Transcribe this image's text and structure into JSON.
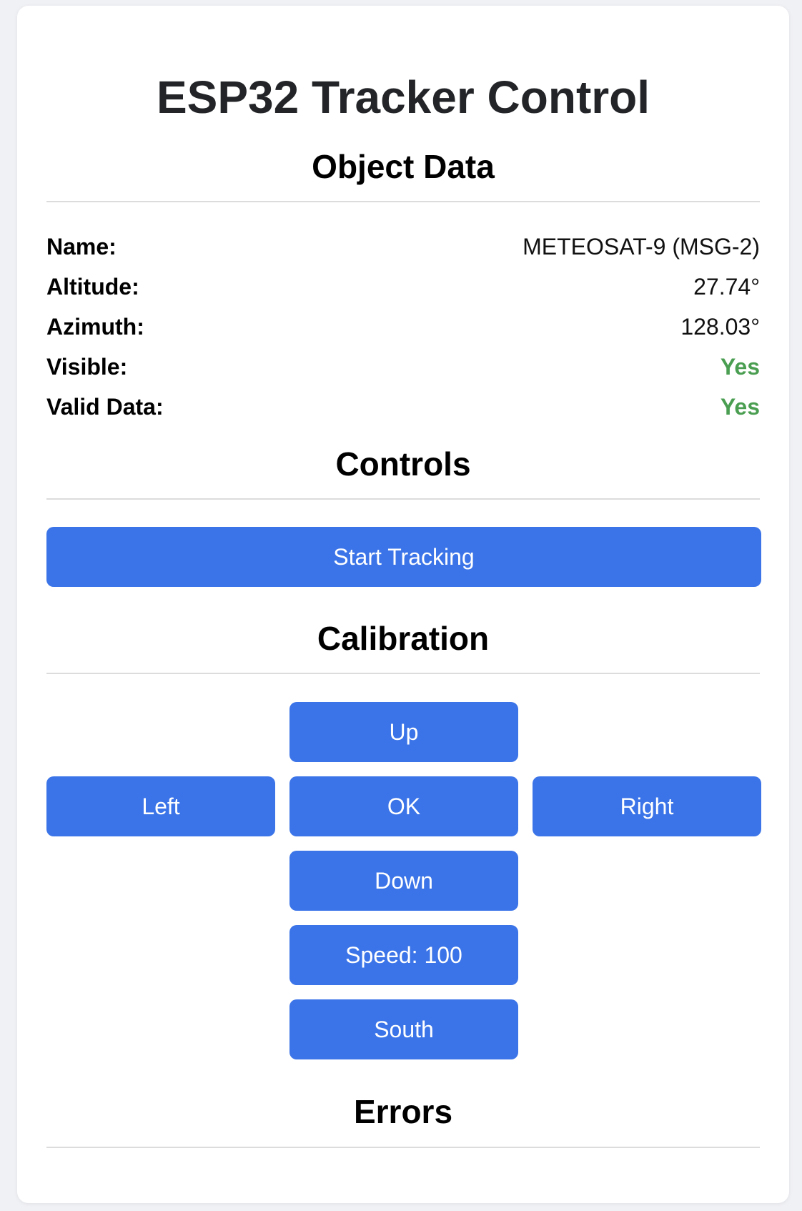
{
  "page": {
    "title": "ESP32 Tracker Control"
  },
  "object_data": {
    "heading": "Object Data",
    "rows": [
      {
        "label": "Name:",
        "value": "METEOSAT-9 (MSG-2)"
      },
      {
        "label": "Altitude:",
        "value": "27.74°"
      },
      {
        "label": "Azimuth:",
        "value": "128.03°"
      },
      {
        "label": "Visible:",
        "value": "Yes"
      },
      {
        "label": "Valid Data:",
        "value": "Yes"
      }
    ],
    "status_color": "#4a9e51"
  },
  "controls": {
    "heading": "Controls",
    "start_tracking_label": "Start Tracking"
  },
  "calibration": {
    "heading": "Calibration",
    "up_label": "Up",
    "left_label": "Left",
    "ok_label": "OK",
    "right_label": "Right",
    "down_label": "Down",
    "speed_label": "Speed: 100",
    "south_label": "South"
  },
  "errors": {
    "heading": "Errors"
  },
  "colors": {
    "button_blue": "#3b74e8",
    "background": "#f0f1f5",
    "card": "#ffffff"
  }
}
